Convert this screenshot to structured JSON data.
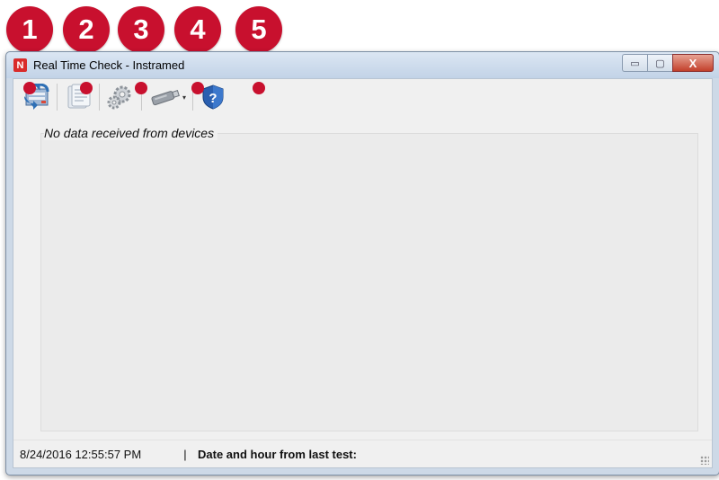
{
  "callouts": [
    "1",
    "2",
    "3",
    "4",
    "5"
  ],
  "window": {
    "title": "Real Time Check - Instramed",
    "app_icon_letter": "N",
    "controls": {
      "minimize": "▭",
      "maximize": "▢",
      "close": "X"
    }
  },
  "toolbar": {
    "buttons": [
      {
        "id": "sync",
        "icon": "sync-transfer-icon"
      },
      {
        "id": "report",
        "icon": "document-icon"
      },
      {
        "id": "settings",
        "icon": "gears-icon"
      },
      {
        "id": "device",
        "icon": "usb-device-icon",
        "has_dropdown": true
      },
      {
        "id": "help",
        "icon": "help-shield-icon"
      }
    ],
    "dropdown_glyph": "▾"
  },
  "main": {
    "status_message": "No data received from devices"
  },
  "statusbar": {
    "timestamp": "8/24/2016 12:55:57 PM",
    "separator": "|",
    "last_test_label": "Date and hour from last test:"
  },
  "colors": {
    "callout": "#c8102e",
    "titlebar": "#c2d3e7",
    "close_button": "#c2402b",
    "client_bg": "#f0f0f0"
  }
}
